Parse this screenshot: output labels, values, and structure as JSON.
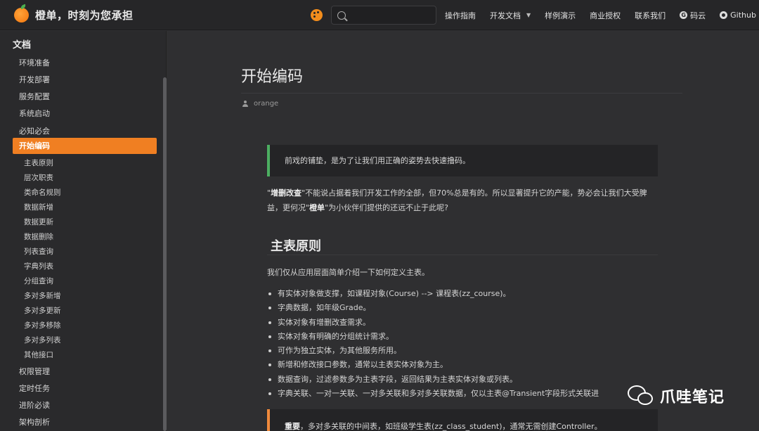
{
  "header": {
    "brand_title": "橙单，时刻为您承担",
    "search": {
      "value": "",
      "placeholder": ""
    },
    "nav": {
      "guide": "操作指南",
      "dev_docs": "开发文档",
      "demo": "样例演示",
      "license": "商业授权",
      "contact": "联系我们",
      "gitee": "码云",
      "github": "Github"
    }
  },
  "sidebar": {
    "heading": "文档",
    "items_top": [
      "环境准备",
      "开发部署",
      "服务配置",
      "系统启动",
      "必知必会"
    ],
    "active": "开始编码",
    "sub_items": [
      "主表原则",
      "层次职责",
      "类命名规则",
      "数据新增",
      "数据更新",
      "数据删除",
      "列表查询",
      "字典列表",
      "分组查询",
      "多对多新增",
      "多对多更新",
      "多对多移除",
      "多对多列表",
      "其他接口"
    ],
    "items_bottom": [
      "权限管理",
      "定时任务",
      "进阶必读",
      "架构剖析"
    ]
  },
  "content": {
    "title": "开始编码",
    "author": "orange",
    "note_green": "前戏的铺垫，是为了让我们用正确的姿势去快速撸码。",
    "para_1": {
      "q1": "\"",
      "b1": "增删改查",
      "t1": "\"不能说占据着我们开发工作的全部，但70%总是有的。所以显著提升它的产能，势必会让我们大受脾益，更何况\"",
      "b2": "橙单",
      "t2": "\"为小伙伴们提供的还远不止于此呢?"
    },
    "section_title": "主表原则",
    "intro": "我们仅从应用层面简单介绍一下如何定义主表。",
    "bullets": [
      "有实体对象做支撑，如课程对象(Course) --> 课程表(zz_course)。",
      "字典数据，如年级Grade。",
      "实体对象有增删改查需求。",
      "实体对象有明确的分组统计需求。",
      "可作为独立实体，为其他服务所用。",
      "新增和修改接口参数，通常以主表实体对象为主。",
      "数据查询，过滤参数多为主表字段，返回结果为主表实体对象或列表。",
      "字典关联、一对一关联、一对多关联和多对多关联数据，仅以主表@Transient字段形式关联进"
    ],
    "note_orange": {
      "bold": "重要",
      "text": "，多对多关联的中间表，如班级学生表(zz_class_student)，通常无需创建Controller。"
    },
    "watermark": "爪哇笔记"
  },
  "colors": {
    "accent": "#f07f22",
    "note_green": "#4caf61",
    "note_orange": "#f08a3c",
    "background": "#2f2f31"
  }
}
